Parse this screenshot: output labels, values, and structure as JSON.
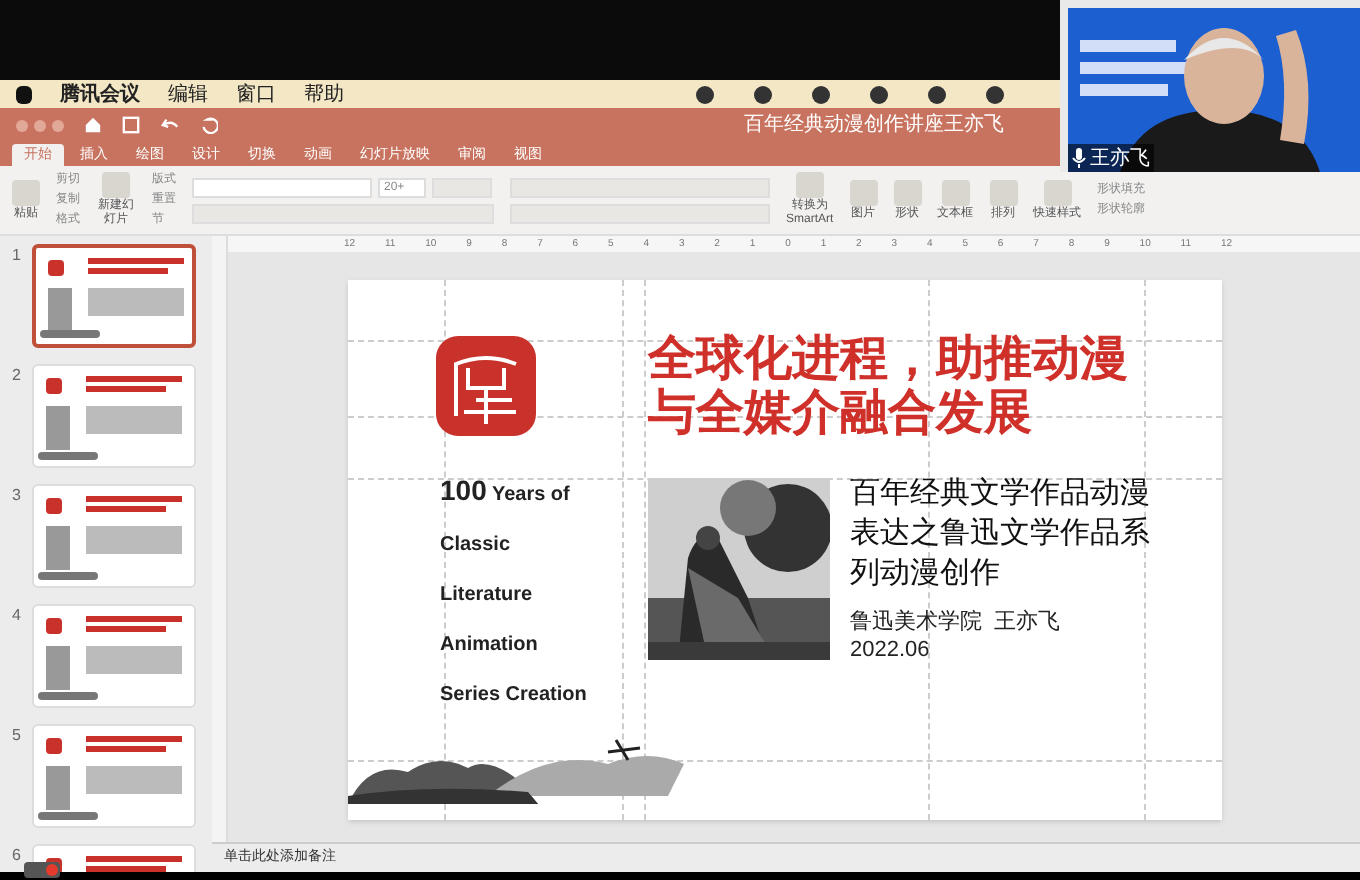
{
  "menu_bar": {
    "items": [
      "腾讯会议",
      "编辑",
      "窗口",
      "帮助"
    ]
  },
  "window": {
    "title": "百年经典动漫创作讲座王亦飞"
  },
  "tabs": [
    {
      "label": "开始",
      "selected": true
    },
    {
      "label": "插入",
      "selected": false
    },
    {
      "label": "绘图",
      "selected": false
    },
    {
      "label": "设计",
      "selected": false
    },
    {
      "label": "切换",
      "selected": false
    },
    {
      "label": "动画",
      "selected": false
    },
    {
      "label": "幻灯片放映",
      "selected": false
    },
    {
      "label": "审阅",
      "selected": false
    },
    {
      "label": "视图",
      "selected": false
    }
  ],
  "ribbon": {
    "paste": "粘贴",
    "clipboard": [
      "剪切",
      "复制",
      "格式"
    ],
    "new_slide": "新建幻灯片",
    "slide_tools": [
      "版式",
      "重置",
      "节"
    ],
    "font_size": "20+",
    "smartart": "转换为\nSmartArt",
    "insert": [
      "图片",
      "形状",
      "文本框"
    ],
    "arrange": "排列",
    "quick_styles": "快速样式",
    "shape_tools": [
      "形状填充",
      "形状轮廓"
    ]
  },
  "ruler_labels": [
    "12",
    "11",
    "10",
    "9",
    "8",
    "7",
    "6",
    "5",
    "4",
    "3",
    "2",
    "1",
    "0",
    "1",
    "2",
    "3",
    "4",
    "5",
    "6",
    "7",
    "8",
    "9",
    "10",
    "11",
    "12"
  ],
  "slides": [
    {
      "number": "1",
      "selected": true
    },
    {
      "number": "2",
      "selected": false
    },
    {
      "number": "3",
      "selected": false
    },
    {
      "number": "4",
      "selected": false
    },
    {
      "number": "5",
      "selected": false
    },
    {
      "number": "6",
      "selected": false
    }
  ],
  "slide": {
    "title_lines": [
      "全球化进程，助推动漫",
      "与全媒介融合发展"
    ],
    "english_lines": [
      "**100** Years of",
      "Classic",
      "Literature",
      "Animation",
      "Series Creation"
    ],
    "subtitle_lines": [
      "百年经典文学作品动漫",
      "表达之鲁迅文学作品系",
      "列动漫创作"
    ],
    "author": "鲁迅美术学院  王亦飞",
    "date": "2022.06"
  },
  "notes": {
    "placeholder": "单击此处添加备注"
  },
  "video": {
    "speaker": "王亦飞"
  }
}
